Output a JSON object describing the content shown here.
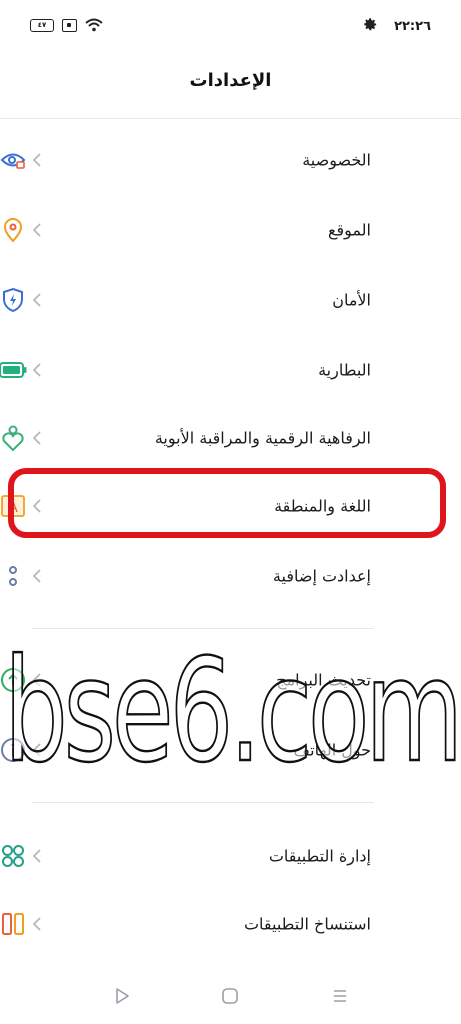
{
  "status_bar": {
    "battery_text": "٤٧",
    "time": "٢٢:٢٦",
    "icons": [
      "battery-icon",
      "sim-icon",
      "wifi-icon",
      "gear-icon"
    ]
  },
  "header": {
    "title": "الإعدادات"
  },
  "settings": {
    "items": [
      {
        "label": "الخصوصية",
        "icon": "privacy-eye-icon",
        "color": "#3b6fd8"
      },
      {
        "label": "الموقع",
        "icon": "location-pin-icon",
        "color": "#f0a020"
      },
      {
        "label": "الأمان",
        "icon": "security-shield-icon",
        "color": "#3b6fd8"
      },
      {
        "label": "البطارية",
        "icon": "battery-icon",
        "color": "#22b07d"
      },
      {
        "label": "الرفاهية الرقمية والمراقبة الأبوية",
        "icon": "wellbeing-heart-icon",
        "color": "#3bb07a"
      },
      {
        "label": "اللغة والمنطقة",
        "icon": "language-a-icon",
        "color": "#e8603c"
      },
      {
        "label": "إعدادت إضافية",
        "icon": "more-dots-icon",
        "color": "#6b7ea8"
      },
      {
        "label": "تحديث البرامج",
        "icon": "update-arrow-icon",
        "color": "#2fae5e"
      },
      {
        "label": "حول الهاتف",
        "icon": "info-icon",
        "color": "#6b7ea8"
      },
      {
        "label": "إدارة التطبيقات",
        "icon": "apps-grid-icon",
        "color": "#22a08a"
      },
      {
        "label": "استنساخ التطبيقات",
        "icon": "clone-apps-icon",
        "color": "#e8603c"
      }
    ]
  },
  "watermark": {
    "text": "bse6.com"
  },
  "nav_bar": {
    "icons": [
      "back-icon",
      "home-icon",
      "recents-icon"
    ]
  },
  "highlight_color": "#e0141b"
}
